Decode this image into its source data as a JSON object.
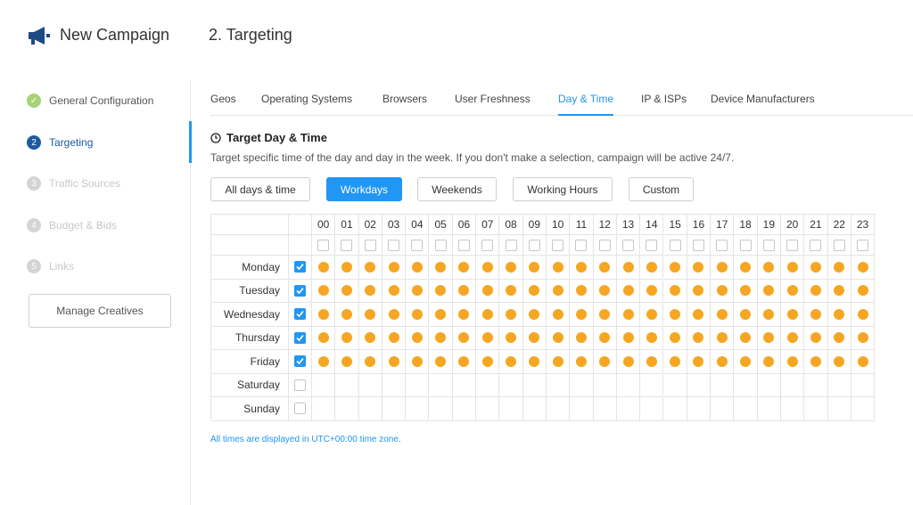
{
  "header": {
    "app_title": "New Campaign",
    "step_title": "2. Targeting",
    "logo_icon": "megaphone-icon"
  },
  "sidebar": {
    "steps": [
      {
        "number": "✓",
        "label": "General Configuration",
        "state": "done"
      },
      {
        "number": "2",
        "label": "Targeting",
        "state": "active"
      },
      {
        "number": "3",
        "label": "Traffic Sources",
        "state": "disabled"
      },
      {
        "number": "4",
        "label": "Budget & Bids",
        "state": "disabled"
      },
      {
        "number": "5",
        "label": "Links",
        "state": "disabled"
      }
    ],
    "manage_button": "Manage Creatives"
  },
  "tabs": [
    {
      "label": "Geos",
      "active": false
    },
    {
      "label": "Operating Systems",
      "active": false
    },
    {
      "label": "Browsers",
      "active": false
    },
    {
      "label": "User Freshness",
      "active": false
    },
    {
      "label": "Day & Time",
      "active": true
    },
    {
      "label": "IP & ISPs",
      "active": false
    },
    {
      "label": "Device Manufacturers",
      "active": false
    }
  ],
  "section": {
    "title": "Target Day & Time",
    "description": "Target specific time of the day and day in the week. If you don't make a selection, campaign will be active 24/7."
  },
  "presets": [
    {
      "label": "All days & time",
      "active": false
    },
    {
      "label": "Workdays",
      "active": true
    },
    {
      "label": "Weekends",
      "active": false
    },
    {
      "label": "Working Hours",
      "active": false
    },
    {
      "label": "Custom",
      "active": false
    }
  ],
  "schedule": {
    "hours": [
      "00",
      "01",
      "02",
      "03",
      "04",
      "05",
      "06",
      "07",
      "08",
      "09",
      "10",
      "11",
      "12",
      "13",
      "14",
      "15",
      "16",
      "17",
      "18",
      "19",
      "20",
      "21",
      "22",
      "23"
    ],
    "days": [
      {
        "label": "Monday",
        "checked": true
      },
      {
        "label": "Tuesday",
        "checked": true
      },
      {
        "label": "Wednesday",
        "checked": true
      },
      {
        "label": "Thursday",
        "checked": true
      },
      {
        "label": "Friday",
        "checked": true
      },
      {
        "label": "Saturday",
        "checked": false
      },
      {
        "label": "Sunday",
        "checked": false
      }
    ]
  },
  "timezone_note": "All times are displayed in UTC+00:00 time zone.",
  "colors": {
    "accent": "#2196f3",
    "active_step": "#1e5aa0",
    "done_step": "#8bc34a",
    "selected_slot": "#f5a623"
  }
}
